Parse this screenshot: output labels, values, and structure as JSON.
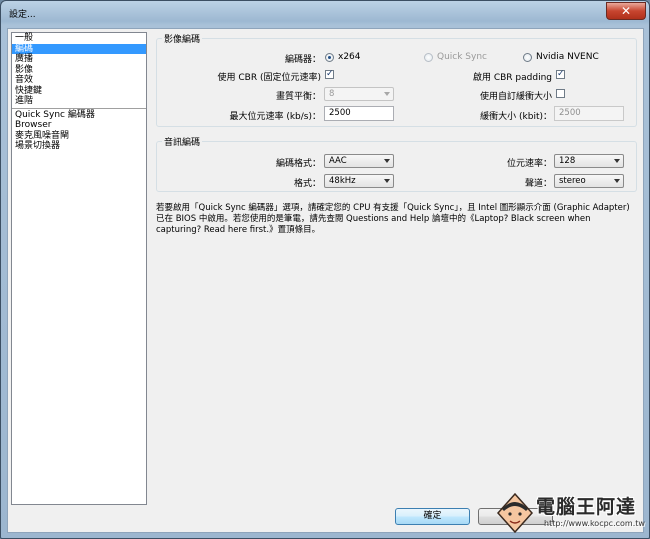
{
  "window": {
    "title": "設定..."
  },
  "sidebar": {
    "items": [
      {
        "label": "一般",
        "selected": false
      },
      {
        "label": "編碼",
        "selected": true
      },
      {
        "label": "廣播",
        "selected": false
      },
      {
        "label": "影像",
        "selected": false
      },
      {
        "label": "音效",
        "selected": false
      },
      {
        "label": "快捷鍵",
        "selected": false
      },
      {
        "label": "進階",
        "selected": false
      }
    ],
    "plugins": [
      {
        "label": "Quick Sync 編碼器"
      },
      {
        "label": "Browser"
      },
      {
        "label": "麥克風噪音閘"
      },
      {
        "label": "場景切換器"
      }
    ]
  },
  "video": {
    "group_title": "影像編碼",
    "encoder_label": "編碼器：",
    "encoders": [
      {
        "label": "x264",
        "checked": true,
        "disabled": false
      },
      {
        "label": "Quick Sync",
        "checked": false,
        "disabled": true
      },
      {
        "label": "Nvidia NVENC",
        "checked": false,
        "disabled": false
      }
    ],
    "cbr_label": "使用 CBR (固定位元速率)",
    "cbr_checked": true,
    "cbr_padding_label": "啟用 CBR padding",
    "cbr_padding_checked": true,
    "quality_label": "畫質平衡：",
    "quality_value": "8",
    "custom_buffer_label": "使用自訂緩衝大小",
    "custom_buffer_checked": false,
    "max_bitrate_label": "最大位元速率 (kb/s)：",
    "max_bitrate_value": "2500",
    "buffer_size_label": "緩衝大小 (kbit)：",
    "buffer_size_value": "2500"
  },
  "audio": {
    "group_title": "音訊編碼",
    "codec_label": "編碼格式：",
    "codec_value": "AAC",
    "bitrate_label": "位元速率：",
    "bitrate_value": "128",
    "format_label": "格式：",
    "format_value": "48kHz",
    "channels_label": "聲道：",
    "channels_value": "stereo"
  },
  "info_text": "若要啟用「Quick Sync 編碼器」選項，請確定您的 CPU 有支援「Quick Sync」，且 Intel 圖形顯示介面 (Graphic Adapter) 已在 BIOS 中啟用。若您使用的是筆電，請先查閱 Questions and Help 論壇中的《Laptop? Black screen when capturing? Read here first.》置頂條目。",
  "buttons": {
    "ok": "確定",
    "cancel": ""
  },
  "watermark": {
    "name": "電腦王阿達",
    "url": "http://www.kocpc.com.tw"
  }
}
